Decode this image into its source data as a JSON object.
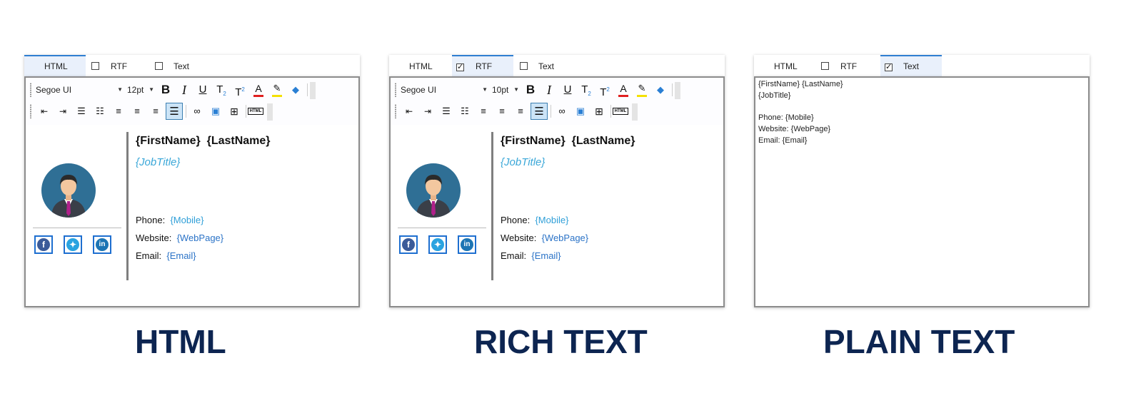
{
  "colors": {
    "caption": "#0d2551",
    "accent_tab": "#2f7fd1",
    "job_title": "#3aa7d8",
    "link": "#2b73c7"
  },
  "tabs": {
    "html": "HTML",
    "rtf": "RTF",
    "text": "Text"
  },
  "toolbar": {
    "font_family": "Segoe UI",
    "font_size_html": "12pt",
    "font_size_rtf": "10pt",
    "icons": [
      "bold-icon",
      "italic-icon",
      "underline-icon",
      "subscript-icon",
      "superscript-icon",
      "font-color-icon",
      "highlight-icon",
      "clear-format-icon",
      "outdent-icon",
      "indent-icon",
      "bullet-list-icon",
      "numbered-list-icon",
      "align-left-icon",
      "align-center-icon",
      "align-right-icon",
      "justify-icon",
      "link-icon",
      "image-icon",
      "table-icon",
      "html-source-icon"
    ]
  },
  "signature": {
    "first_name": "{FirstName}",
    "last_name": "{LastName}",
    "job_title": "{JobTitle}",
    "phone_label": "Phone:",
    "phone_value": "{Mobile}",
    "website_label": "Website:",
    "website_value": "{WebPage}",
    "email_label": "Email:",
    "email_value": "{Email}",
    "social": [
      "facebook-icon",
      "twitter-icon",
      "linkedin-icon"
    ]
  },
  "plain_text": "{FirstName} {LastName}\n{JobTitle}\n\nPhone: {Mobile}\nWebsite: {WebPage}\nEmail: {Email}",
  "captions": {
    "html": "HTML",
    "rich": "RICH TEXT",
    "plain": "PLAIN TEXT"
  }
}
